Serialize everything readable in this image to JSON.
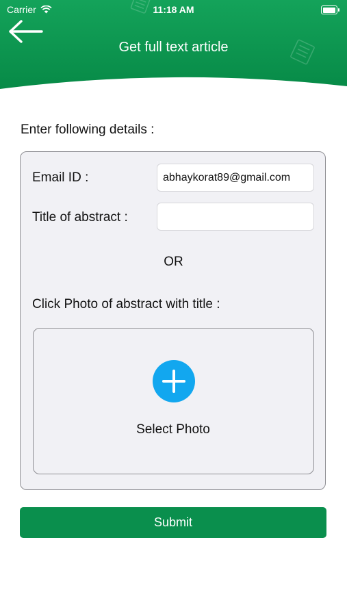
{
  "status_bar": {
    "carrier": "Carrier",
    "time": "11:18 AM"
  },
  "header": {
    "title": "Get full text article",
    "brand_color": "#0a8f4d"
  },
  "form": {
    "prompt": "Enter following details :",
    "email_label": "Email ID :",
    "email_value": "abhaykorat89@gmail.com",
    "title_label": "Title of abstract :",
    "title_value": "",
    "or_text": "OR",
    "photo_label": "Click Photo of abstract with title :",
    "select_photo": "Select Photo",
    "plus_color": "#12a7ef"
  },
  "submit_label": "Submit",
  "icons": [
    "wifi-icon",
    "battery-icon",
    "back-arrow-icon",
    "plus-icon"
  ]
}
